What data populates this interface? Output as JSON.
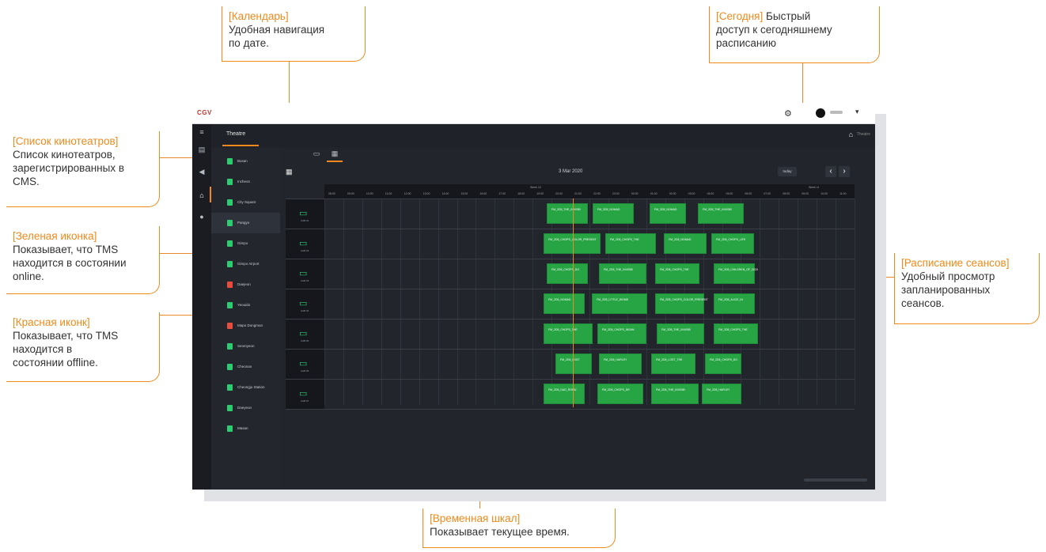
{
  "callouts": {
    "calendar": {
      "tag": "[Календарь]",
      "text1": "Удобная навигация",
      "text2": "по дате."
    },
    "today": {
      "tag": "[Сегодня]",
      "text0": " Быстрый",
      "text1": "доступ к сегодняшнему",
      "text2": "расписанию"
    },
    "theaters": {
      "tag": "[Список кинотеатров]",
      "text1": "Список кинотеатров,",
      "text2": "зарегистрированных в",
      "text3": "CMS."
    },
    "green": {
      "tag": "[Зеленая иконка]",
      "text1": "Показывает, что TMS",
      "text2": "находится в состоянии",
      "text3": "online."
    },
    "red": {
      "tag": "[Красная иконк]",
      "text1": "Показывает, что TMS",
      "text2": "находится в",
      "text3": "состоянии offline."
    },
    "schedule": {
      "tag": "[Расписание сеансов]",
      "text1": "Удобный просмотр",
      "text2": "запланированных",
      "text3": "сеансов."
    },
    "timeline": {
      "tag": "[Временная шкал]",
      "text1": "Показывает текущее время."
    }
  },
  "app": {
    "logo": "CGV",
    "subnav_title": "Theatre",
    "breadcrumb": "Theatre",
    "date": "3 Mar 2020",
    "today_button": "today",
    "prev_label": "‹",
    "next_label": "›",
    "weeks": [
      "Week 10",
      "Week 11"
    ],
    "ticks": [
      "08:00",
      "09:00",
      "10:00",
      "11:00",
      "12:00",
      "13:00",
      "14:00",
      "15:00",
      "16:00",
      "17:00",
      "18:00",
      "19:00",
      "20:00",
      "21:00",
      "22:00",
      "23:00",
      "00:00",
      "01:00",
      "02:00",
      "03:00",
      "04:00",
      "05:00",
      "06:00",
      "07:00",
      "08:00",
      "09:00",
      "10:00",
      "11:00"
    ],
    "theaters": [
      {
        "name": "Busan",
        "status": "online"
      },
      {
        "name": "Incheon",
        "status": "online"
      },
      {
        "name": "City Square",
        "status": "online"
      },
      {
        "name": "Pangyo",
        "status": "online"
      },
      {
        "name": "Gimpo",
        "status": "online"
      },
      {
        "name": "Gimpo Airport",
        "status": "online"
      },
      {
        "name": "Daejeon",
        "status": "offline"
      },
      {
        "name": "Yeouido",
        "status": "online"
      },
      {
        "name": "Mapo Dongmun",
        "status": "offline"
      },
      {
        "name": "Seomyeon",
        "status": "online"
      },
      {
        "name": "Cheonan",
        "status": "online"
      },
      {
        "name": "Cheongju Station",
        "status": "online"
      },
      {
        "name": "Daeyeon",
        "status": "online"
      },
      {
        "name": "Masan",
        "status": "online"
      }
    ],
    "rooms": [
      "CAB 01",
      "CAB 02",
      "CAB 03",
      "CAB 04",
      "CAB 05",
      "CAB 06",
      "CAB 07"
    ],
    "shows": [
      [
        "FM_2D5_THE_INVISIB",
        "FM_2D5_NOMAD",
        "FM_2D5_NOMAD",
        "FM_2D5_THE_INVISIB"
      ],
      [
        "FM_2D5_CHOPS_COLOR_PRESENT",
        "FM_2D5_CHOPS_THE",
        "FM_2D5_NOMAD",
        "FM_2D5_CHOPS_LIFE"
      ],
      [
        "FM_2D5_CHOPS_DO",
        "FM_2D5_THE_INVISIB",
        "FM_2D5_CHOPS_THE",
        "FM_2D5_CHILDREN_OF_2020"
      ],
      [
        "FM_2D5_NOMAD",
        "FM_2D5_LITTLE_WOME",
        "FM_2D5_CHOPS_COLOR_PRESENT",
        "FM_2D5_ALICE_IN"
      ],
      [
        "FM_2D5_CHOPS_THE",
        "FM_2D5_CHOPS_INSAN",
        "FM_2D5_THE_INVISIB",
        "FM_2D5_CHOPS_THE"
      ],
      [
        "FM_2D5_LOST",
        "FM_2D5_HARLEY",
        "FM_2D5_LOST_THE",
        "FM_2D5_CHOPS_DO"
      ],
      [
        "FM_2D5_DAD_ROMU",
        "FM_2D5_CHOPS_DR",
        "FM_2D5_THE_INVISIB",
        "FM_2D5_HARLEY"
      ]
    ]
  },
  "colors": {
    "accent": "#f08a1c",
    "online": "#2ecc71",
    "offline": "#e74c3c",
    "show": "#27a544"
  }
}
